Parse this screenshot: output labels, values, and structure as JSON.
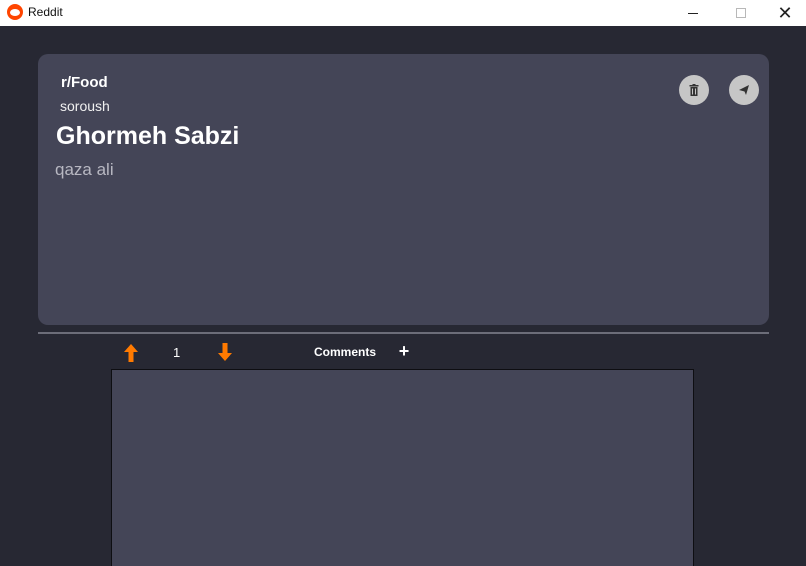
{
  "window": {
    "title": "Reddit"
  },
  "post": {
    "subreddit": "r/Food",
    "author": "soroush",
    "title": "Ghormeh Sabzi",
    "body": "qaza ali"
  },
  "votes": {
    "count": "1"
  },
  "comments": {
    "label": "Comments"
  },
  "icons": {
    "app": "reddit-logo-icon",
    "delete": "trash-icon",
    "share": "send-icon",
    "upvote": "arrow-up-icon",
    "downvote": "arrow-down-icon",
    "add": "plus-icon"
  },
  "colors": {
    "background": "#272833",
    "card": "#444557",
    "accent": "#ff7a00"
  }
}
